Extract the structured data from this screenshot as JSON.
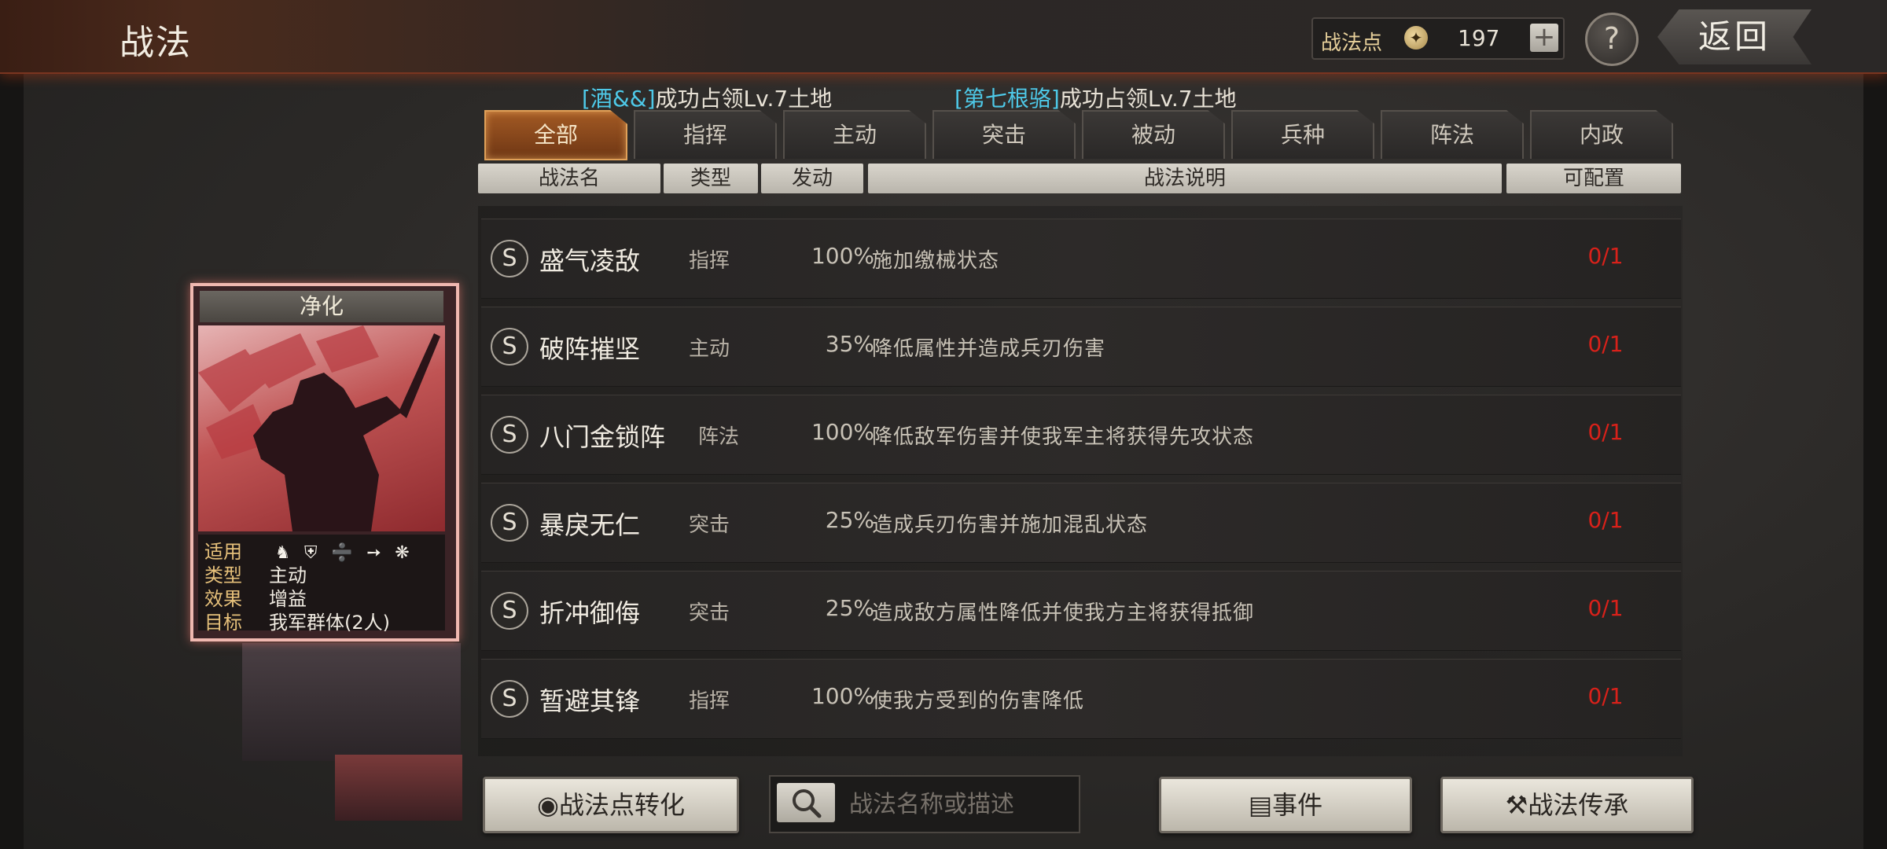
{
  "header": {
    "title": "战法",
    "points_label": "战法点",
    "points_value": "197",
    "plus_label": "+",
    "help_label": "?",
    "back_label": "返回"
  },
  "news": [
    {
      "name": "[酒&&]",
      "text": "成功占领Lv.7土地"
    },
    {
      "name": "[第七根骆]",
      "text": "成功占领Lv.7土地"
    }
  ],
  "tabs": [
    {
      "label": "全部",
      "active": true
    },
    {
      "label": "指挥",
      "active": false
    },
    {
      "label": "主动",
      "active": false
    },
    {
      "label": "突击",
      "active": false
    },
    {
      "label": "被动",
      "active": false
    },
    {
      "label": "兵种",
      "active": false
    },
    {
      "label": "阵法",
      "active": false
    },
    {
      "label": "内政",
      "active": false
    }
  ],
  "columns": [
    "战法名",
    "类型",
    "发动",
    "战法说明",
    "可配置"
  ],
  "rows": [
    {
      "grade": "S",
      "name": "盛气凌敌",
      "type": "指挥",
      "rate": "100%",
      "desc": "施加缴械状态",
      "cfg": "0/1"
    },
    {
      "grade": "S",
      "name": "破阵摧坚",
      "type": "主动",
      "rate": "35%",
      "desc": "降低属性并造成兵刃伤害",
      "cfg": "0/1"
    },
    {
      "grade": "S",
      "name": "八门金锁阵",
      "type": "阵法",
      "rate": "100%",
      "desc": "降低敌军伤害并使我军主将获得先攻状态",
      "cfg": "0/1"
    },
    {
      "grade": "S",
      "name": "暴戾无仁",
      "type": "突击",
      "rate": "25%",
      "desc": "造成兵刃伤害并施加混乱状态",
      "cfg": "0/1"
    },
    {
      "grade": "S",
      "name": "折冲御侮",
      "type": "突击",
      "rate": "25%",
      "desc": "造成敌方属性降低并使我方主将获得抵御",
      "cfg": "0/1"
    },
    {
      "grade": "S",
      "name": "暂避其锋",
      "type": "指挥",
      "rate": "100%",
      "desc": "使我方受到的伤害降低",
      "cfg": "0/1"
    }
  ],
  "card": {
    "title": "净化",
    "apply_key": "适用",
    "troop_icons": [
      "cavalry-icon",
      "shield-icon",
      "bow-icon",
      "spear-icon",
      "wheel-icon"
    ],
    "type_key": "类型",
    "type_val": "主动",
    "effect_key": "效果",
    "effect_val": "增益",
    "target_key": "目标",
    "target_val": "我军群体(2人)"
  },
  "bottom": {
    "convert_label": "战法点转化",
    "search_placeholder": "战法名称或描述",
    "event_label": "事件",
    "inherit_label": "战法传承"
  },
  "colors": {
    "accent": "#e0a058",
    "cfg_red": "#d8211a",
    "news_name": "#4ec9e8"
  }
}
